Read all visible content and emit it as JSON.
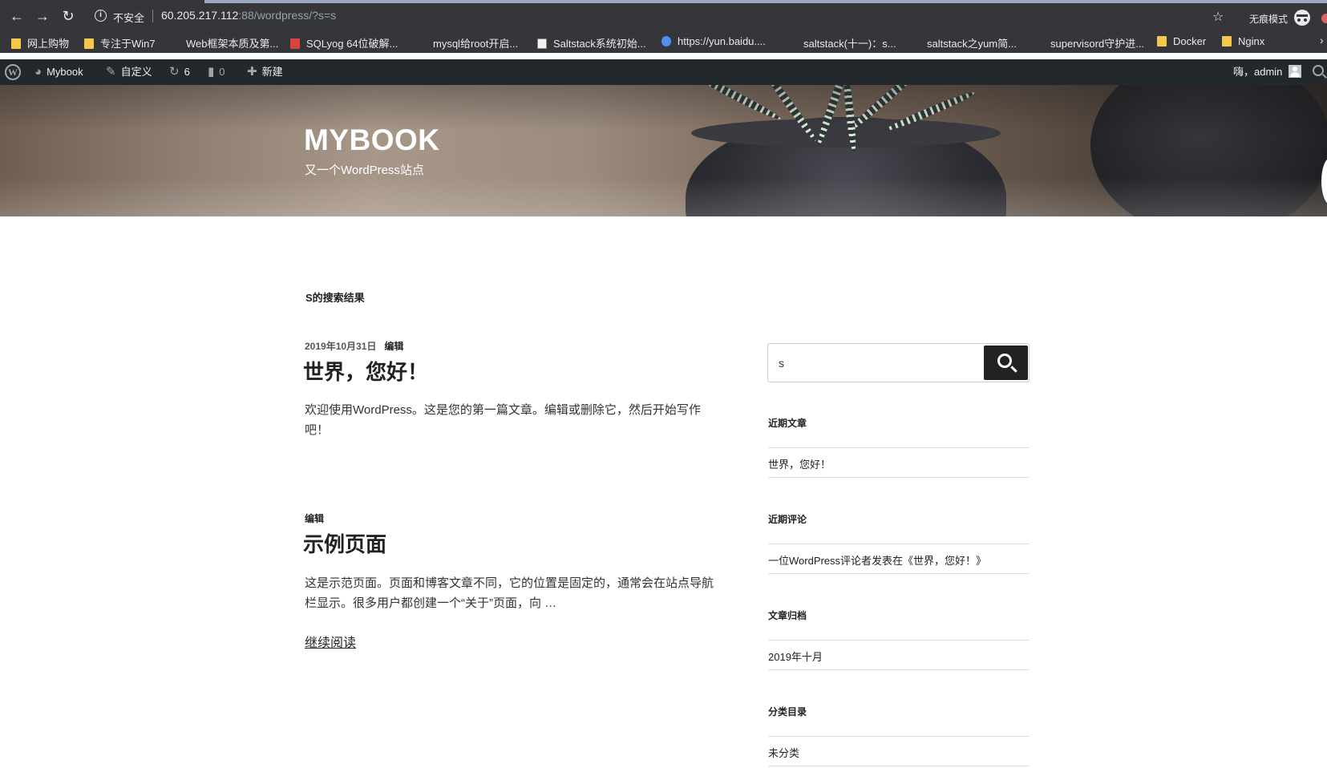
{
  "browser": {
    "security_label": "不安全",
    "url_host": "60.205.217.112",
    "url_rest": ":88/wordpress/?s=s",
    "incognito_label": "无痕模式",
    "bookmarks": [
      {
        "label": "网上购物",
        "icon": "folder-icon"
      },
      {
        "label": "专注于Win7",
        "icon": "folder-icon"
      },
      {
        "label": "Web框架本质及第...",
        "icon": "page-icon"
      },
      {
        "label": "SQLyog 64位破解...",
        "icon": "site-icon"
      },
      {
        "label": "mysql给root开启...",
        "icon": "page-icon"
      },
      {
        "label": "Saltstack系统初始...",
        "icon": "site-icon"
      },
      {
        "label": "https://yun.baidu....",
        "icon": "cloud-icon"
      },
      {
        "label": "saltstack(十一)：s...",
        "icon": "page-icon"
      },
      {
        "label": "saltstack之yum简...",
        "icon": "page-icon"
      },
      {
        "label": "supervisord守护进...",
        "icon": "page-icon"
      },
      {
        "label": "Docker",
        "icon": "folder-icon"
      },
      {
        "label": "Nginx",
        "icon": "folder-icon"
      }
    ]
  },
  "admin_bar": {
    "site_name": "Mybook",
    "customize": "自定义",
    "updates_count": "6",
    "comments_count": "0",
    "new_label": "新建",
    "greeting": "嗨，admin"
  },
  "site": {
    "title": "MYBOOK",
    "tagline": "又一个WordPress站点"
  },
  "main": {
    "page_heading": "S的搜索结果",
    "posts": [
      {
        "date": "2019年10月31日",
        "edit": "编辑",
        "title": "世界，您好！",
        "excerpt": "欢迎使用WordPress。这是您的第一篇文章。编辑或删除它，然后开始写作吧！"
      },
      {
        "edit": "编辑",
        "title": "示例页面",
        "excerpt": "这是示范页面。页面和博客文章不同，它的位置是固定的，通常会在站点导航栏显示。很多用户都创建一个“关于”页面，向 …",
        "read_more": "继续阅读"
      }
    ]
  },
  "sidebar": {
    "search_value": "s",
    "recent_posts": {
      "title": "近期文章",
      "items": [
        "世界，您好！"
      ]
    },
    "recent_comments": {
      "title": "近期评论",
      "items": [
        "一位WordPress评论者发表在《世界，您好！》"
      ]
    },
    "archives": {
      "title": "文章归档",
      "items": [
        "2019年十月"
      ]
    },
    "categories": {
      "title": "分类目录",
      "items": [
        "未分类"
      ]
    }
  }
}
